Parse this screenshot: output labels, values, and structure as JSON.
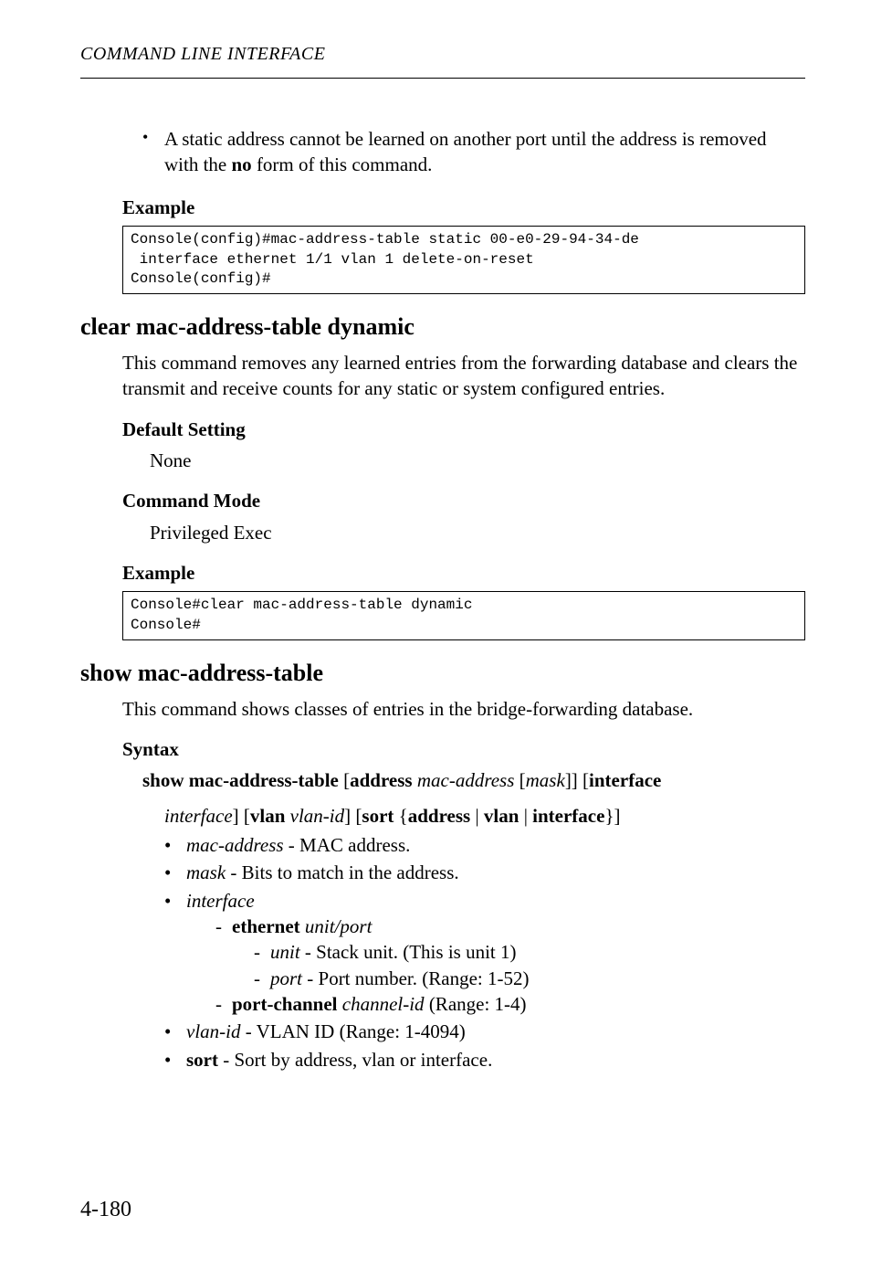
{
  "running_header": "COMMAND LINE INTERFACE",
  "top_bullet": {
    "text_a": "A static address cannot be learned on another port until the address is removed with the ",
    "kw": "no",
    "text_b": " form of this command."
  },
  "sec1": {
    "example_label": "Example",
    "code": "Console(config)#mac-address-table static 00-e0-29-94-34-de\n interface ethernet 1/1 vlan 1 delete-on-reset\nConsole(config)#"
  },
  "sec2": {
    "title": "clear mac-address-table dynamic",
    "para": "This command removes any learned entries from the forwarding database and clears the transmit and receive counts for any static or system configured entries.",
    "default_label": "Default Setting",
    "default_value": "None",
    "mode_label": "Command Mode",
    "mode_value": "Privileged Exec",
    "example_label": "Example",
    "code": "Console#clear mac-address-table dynamic\nConsole#"
  },
  "sec3": {
    "title": "show mac-address-table",
    "para": "This command shows classes of entries in the bridge-forwarding database.",
    "syntax_label": "Syntax",
    "syntax": {
      "cmd": "show mac-address-table",
      "lb1": " [",
      "kw_address": "address",
      "sp1": " ",
      "arg_mac": "mac-address",
      "lb2": " [",
      "arg_mask": "mask",
      "rb2": "]] [",
      "kw_interface": "interface",
      "line2_arg_interface": "interface",
      "line2_rb": "] [",
      "kw_vlan": "vlan",
      "sp2": " ",
      "arg_vlan": "vlan-id",
      "line2_rb2": "] [",
      "kw_sort": "sort",
      "lbrace": " {",
      "kw_addr2": "address",
      "pipe1": " | ",
      "kw_vlan2": "vlan",
      "pipe2": " | ",
      "kw_iface2": "interface",
      "rbrace": "}]"
    },
    "params": {
      "mac_address": {
        "name": "mac-address",
        "desc": " - MAC address."
      },
      "mask": {
        "name": "mask",
        "desc": " - Bits to match in the address."
      },
      "interface": {
        "name": "interface"
      },
      "ethernet": {
        "kw": "ethernet",
        "arg": "unit",
        "slash": "/",
        "arg2": "port"
      },
      "unit": {
        "name": "unit",
        "desc": " - Stack unit. (This is unit 1)"
      },
      "port": {
        "name": "port",
        "desc": " - Port number. (Range: 1-52)"
      },
      "portchannel": {
        "kw": "port-channel",
        "sp": " ",
        "arg": "channel-id",
        "desc": " (Range: 1-4)"
      },
      "vlan_id": {
        "name": "vlan-id",
        "desc": " - VLAN ID (Range: 1-4094)"
      },
      "sort": {
        "name": "sort",
        "desc": " - Sort by address, vlan or interface."
      }
    }
  },
  "page_number": "4-180"
}
